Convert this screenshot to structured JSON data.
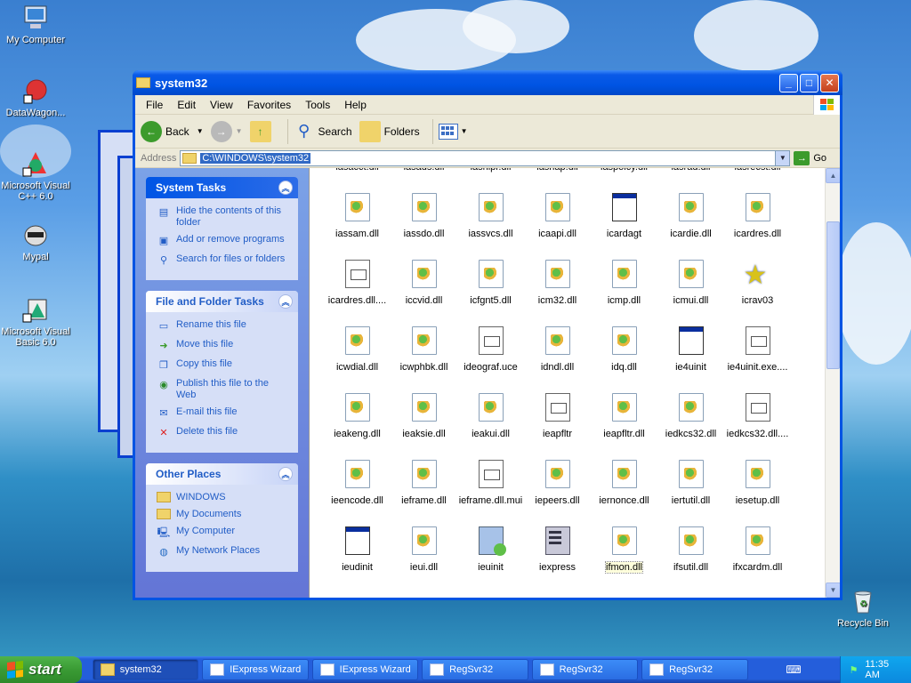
{
  "desktop": {
    "icons": [
      {
        "label": "My Computer",
        "icon": "my-computer-icon"
      },
      {
        "label": "DataWagon...",
        "icon": "datawagon-shortcut-icon"
      },
      {
        "label": "Microsoft Visual C++ 6.0",
        "icon": "visual-cpp-shortcut-icon"
      },
      {
        "label": "Mypal",
        "icon": "mypal-browser-icon"
      },
      {
        "label": "Microsoft Visual Basic 6.0",
        "icon": "visual-basic-shortcut-icon"
      }
    ],
    "recycle_bin": "Recycle Bin"
  },
  "window": {
    "title": "system32",
    "menu": [
      "File",
      "Edit",
      "View",
      "Favorites",
      "Tools",
      "Help"
    ],
    "toolbar": {
      "back": "Back",
      "search": "Search",
      "folders": "Folders"
    },
    "address": {
      "label": "Address",
      "value": "C:\\WINDOWS\\system32",
      "go": "Go"
    }
  },
  "taskpane": {
    "system_tasks": {
      "title": "System Tasks",
      "items": [
        {
          "label": "Hide the contents of this folder",
          "icon": "hide-contents-icon"
        },
        {
          "label": "Add or remove programs",
          "icon": "add-remove-icon"
        },
        {
          "label": "Search for files or folders",
          "icon": "search-icon"
        }
      ]
    },
    "file_tasks": {
      "title": "File and Folder Tasks",
      "items": [
        {
          "label": "Rename this file",
          "icon": "rename-icon"
        },
        {
          "label": "Move this file",
          "icon": "move-icon"
        },
        {
          "label": "Copy this file",
          "icon": "copy-icon"
        },
        {
          "label": "Publish this file to the Web",
          "icon": "publish-web-icon"
        },
        {
          "label": "E-mail this file",
          "icon": "email-icon"
        },
        {
          "label": "Delete this file",
          "icon": "delete-icon"
        }
      ]
    },
    "other_places": {
      "title": "Other Places",
      "items": [
        {
          "label": "WINDOWS",
          "icon": "folder-icon"
        },
        {
          "label": "My Documents",
          "icon": "my-documents-icon"
        },
        {
          "label": "My Computer",
          "icon": "my-computer-icon"
        },
        {
          "label": "My Network Places",
          "icon": "network-places-icon"
        }
      ]
    }
  },
  "files": [
    {
      "name": "iasacct.dll",
      "type": "dll"
    },
    {
      "name": "iasads.dll",
      "type": "dll"
    },
    {
      "name": "iashlpr.dll",
      "type": "dll"
    },
    {
      "name": "iasnap.dll",
      "type": "dll"
    },
    {
      "name": "iaspolcy.dll",
      "type": "dll"
    },
    {
      "name": "iasrad.dll",
      "type": "dll"
    },
    {
      "name": "iasrecst.dll",
      "type": "dll"
    },
    {
      "name": "iassam.dll",
      "type": "dll"
    },
    {
      "name": "iassdo.dll",
      "type": "dll"
    },
    {
      "name": "iassvcs.dll",
      "type": "dll"
    },
    {
      "name": "icaapi.dll",
      "type": "dll"
    },
    {
      "name": "icardagt",
      "type": "win"
    },
    {
      "name": "icardie.dll",
      "type": "dll"
    },
    {
      "name": "icardres.dll",
      "type": "dll"
    },
    {
      "name": "icardres.dll....",
      "type": "doc"
    },
    {
      "name": "iccvid.dll",
      "type": "dll"
    },
    {
      "name": "icfgnt5.dll",
      "type": "dll"
    },
    {
      "name": "icm32.dll",
      "type": "dll"
    },
    {
      "name": "icmp.dll",
      "type": "dll"
    },
    {
      "name": "icmui.dll",
      "type": "dll"
    },
    {
      "name": "icrav03",
      "type": "star"
    },
    {
      "name": "icwdial.dll",
      "type": "dll"
    },
    {
      "name": "icwphbk.dll",
      "type": "dll"
    },
    {
      "name": "ideograf.uce",
      "type": "doc"
    },
    {
      "name": "idndl.dll",
      "type": "dll"
    },
    {
      "name": "idq.dll",
      "type": "dll"
    },
    {
      "name": "ie4uinit",
      "type": "win"
    },
    {
      "name": "ie4uinit.exe....",
      "type": "doc"
    },
    {
      "name": "ieakeng.dll",
      "type": "dll"
    },
    {
      "name": "ieaksie.dll",
      "type": "dll"
    },
    {
      "name": "ieakui.dll",
      "type": "dll"
    },
    {
      "name": "ieapfltr",
      "type": "doc"
    },
    {
      "name": "ieapfltr.dll",
      "type": "dll"
    },
    {
      "name": "iedkcs32.dll",
      "type": "dll"
    },
    {
      "name": "iedkcs32.dll....",
      "type": "doc"
    },
    {
      "name": "ieencode.dll",
      "type": "dll"
    },
    {
      "name": "ieframe.dll",
      "type": "dll"
    },
    {
      "name": "ieframe.dll.mui",
      "type": "doc"
    },
    {
      "name": "iepeers.dll",
      "type": "dll"
    },
    {
      "name": "iernonce.dll",
      "type": "dll"
    },
    {
      "name": "iertutil.dll",
      "type": "dll"
    },
    {
      "name": "iesetup.dll",
      "type": "dll"
    },
    {
      "name": "ieudinit",
      "type": "win"
    },
    {
      "name": "ieui.dll",
      "type": "dll"
    },
    {
      "name": "ieuinit",
      "type": "setup"
    },
    {
      "name": "iexpress",
      "type": "server"
    },
    {
      "name": "ifmon.dll",
      "type": "dll",
      "selected": true
    },
    {
      "name": "ifsutil.dll",
      "type": "dll"
    },
    {
      "name": "ifxcardm.dll",
      "type": "dll"
    }
  ],
  "taskbar": {
    "start": "start",
    "buttons": [
      {
        "label": "system32",
        "active": true,
        "icon": "folder-icon"
      },
      {
        "label": "IExpress Wizard",
        "active": false,
        "icon": "iexpress-icon"
      },
      {
        "label": "IExpress Wizard",
        "active": false,
        "icon": "iexpress-icon"
      },
      {
        "label": "RegSvr32",
        "active": false,
        "icon": "window-icon"
      },
      {
        "label": "RegSvr32",
        "active": false,
        "icon": "window-icon"
      },
      {
        "label": "RegSvr32",
        "active": false,
        "icon": "window-icon"
      }
    ],
    "clock": "11:35 AM"
  }
}
